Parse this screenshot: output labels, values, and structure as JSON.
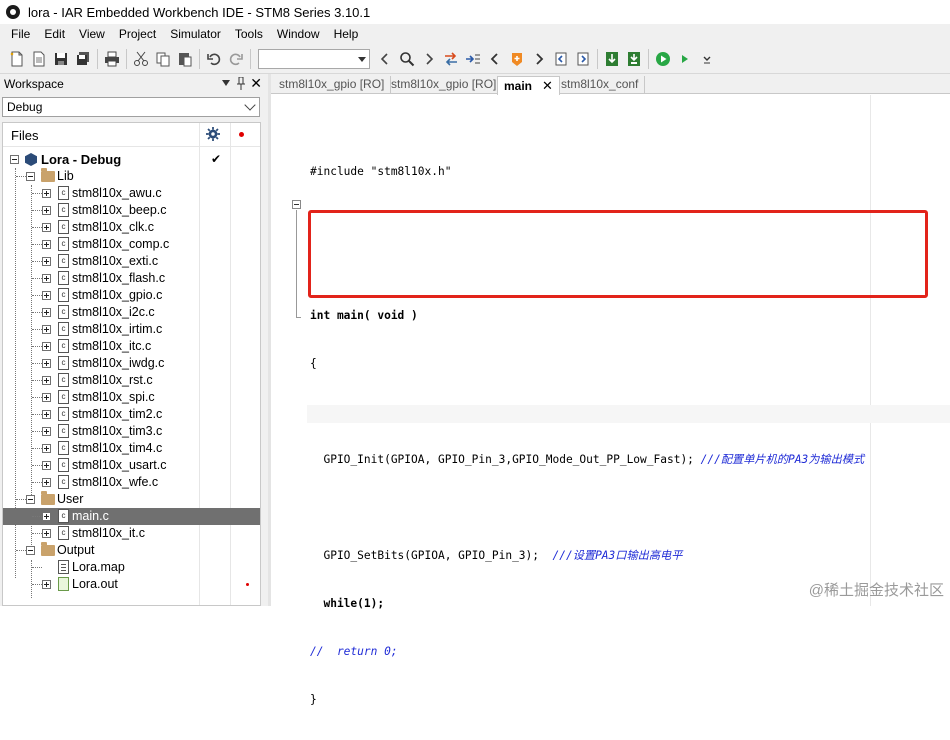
{
  "window": {
    "title": "lora - IAR Embedded Workbench IDE - STM8 Series 3.10.1"
  },
  "menu": {
    "items": [
      "File",
      "Edit",
      "View",
      "Project",
      "Simulator",
      "Tools",
      "Window",
      "Help"
    ]
  },
  "workspace": {
    "title": "Workspace",
    "configuration": "Debug",
    "files_header": "Files",
    "project": "Lora - Debug",
    "groups": {
      "lib": {
        "name": "Lib",
        "files": [
          "stm8l10x_awu.c",
          "stm8l10x_beep.c",
          "stm8l10x_clk.c",
          "stm8l10x_comp.c",
          "stm8l10x_exti.c",
          "stm8l10x_flash.c",
          "stm8l10x_gpio.c",
          "stm8l10x_i2c.c",
          "stm8l10x_irtim.c",
          "stm8l10x_itc.c",
          "stm8l10x_iwdg.c",
          "stm8l10x_rst.c",
          "stm8l10x_spi.c",
          "stm8l10x_tim2.c",
          "stm8l10x_tim3.c",
          "stm8l10x_tim4.c",
          "stm8l10x_usart.c",
          "stm8l10x_wfe.c"
        ]
      },
      "user": {
        "name": "User",
        "files": [
          "main.c",
          "stm8l10x_it.c"
        ]
      },
      "output": {
        "name": "Output",
        "files": [
          "Lora.map",
          "Lora.out"
        ]
      }
    }
  },
  "tabs": [
    {
      "label": "stm8l10x_gpio [RO]"
    },
    {
      "label": "stm8l10x_gpio [RO]"
    },
    {
      "label": "main",
      "close": "✕"
    },
    {
      "label": "stm8l10x_conf"
    }
  ],
  "editor": {
    "lines": {
      "include": "#include \"stm8l10x.h\"",
      "main_sig": "int main( void )",
      "open_brace": "{",
      "init_code": "  GPIO_Init(GPIOA, GPIO_Pin_3,GPIO_Mode_Out_PP_Low_Fast); ",
      "init_comment": "///配置单片机的PA3为输出模式",
      "setbits_code": "  GPIO_SetBits(GPIOA, GPIO_Pin_3);  ",
      "setbits_comment": "///设置PA3口输出高电平",
      "while_line": "  while(1);",
      "return_comment": "//  return 0;",
      "close_brace": "}"
    }
  },
  "watermark": "@稀土掘金技术社区",
  "colors": {
    "highlight_box": "#e2231a",
    "comment": "#1f2bd6",
    "selection": "#707070"
  }
}
